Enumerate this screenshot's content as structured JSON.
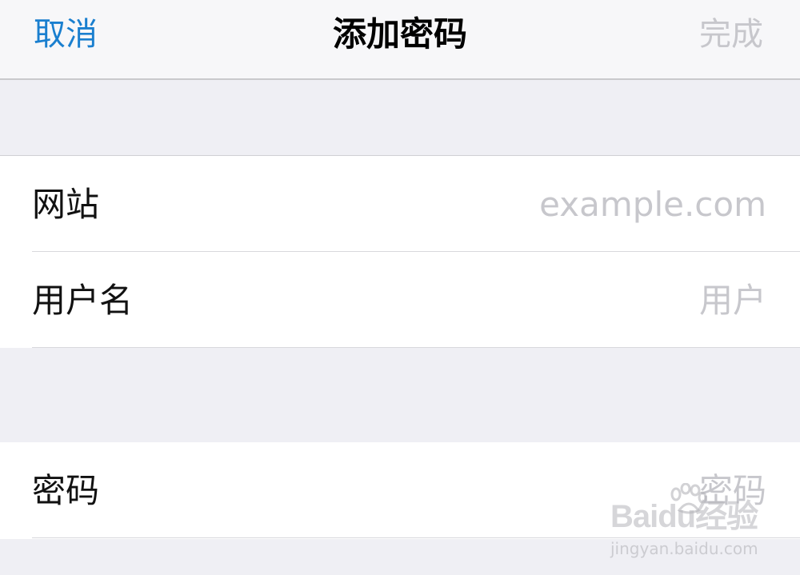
{
  "nav": {
    "cancel_label": "取消",
    "title": "添加密码",
    "done_label": "完成"
  },
  "form": {
    "website": {
      "label": "网站",
      "placeholder": "example.com",
      "value": ""
    },
    "username": {
      "label": "用户名",
      "placeholder": "用户",
      "value": ""
    },
    "password": {
      "label": "密码",
      "placeholder": "密码",
      "value": ""
    }
  },
  "watermark": {
    "logo": "Baidu经验",
    "url": "jingyan.baidu.com"
  },
  "colors": {
    "accent": "#1a7fcf",
    "disabled": "#c7c7cc",
    "background": "#efeff4"
  }
}
